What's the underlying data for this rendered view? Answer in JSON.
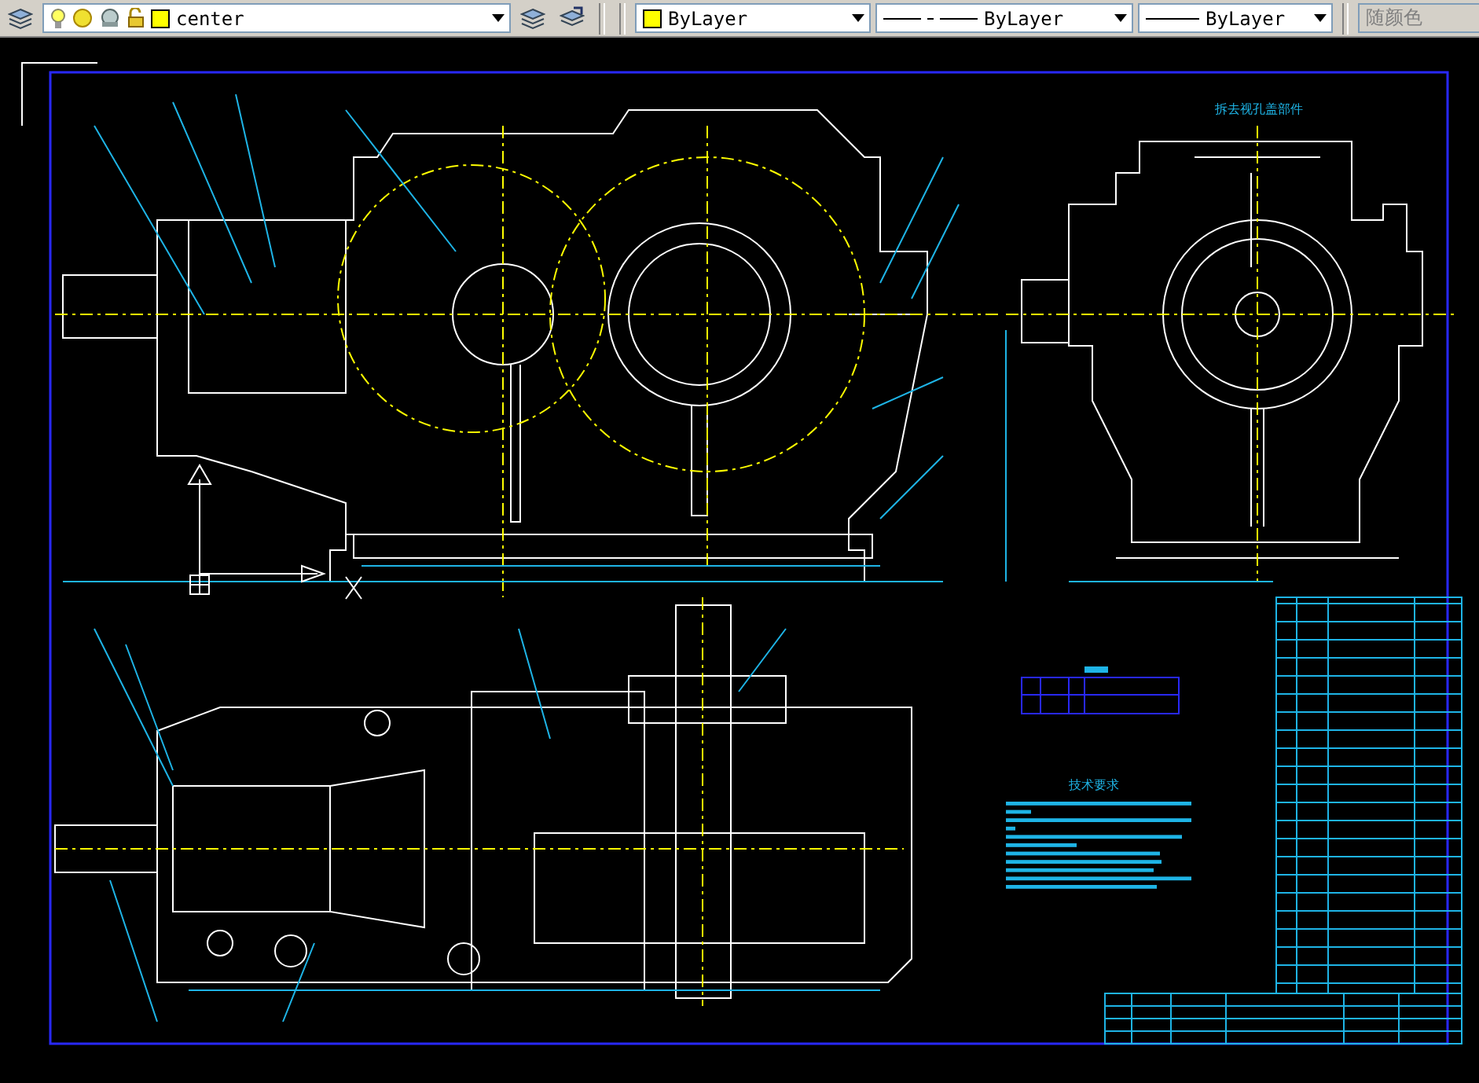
{
  "toolbar": {
    "layer": {
      "name": "center",
      "color": "#ffff00"
    },
    "color": {
      "label": "ByLayer",
      "color": "#ffff00"
    },
    "linetype": {
      "label": "ByLayer"
    },
    "lineweight": {
      "label": "ByLayer"
    },
    "plotstyle": {
      "label": "随颜色",
      "disabled": true
    }
  },
  "drawing": {
    "side_view_caption": "拆去视孔盖部件",
    "notes_heading": "技术要求"
  }
}
